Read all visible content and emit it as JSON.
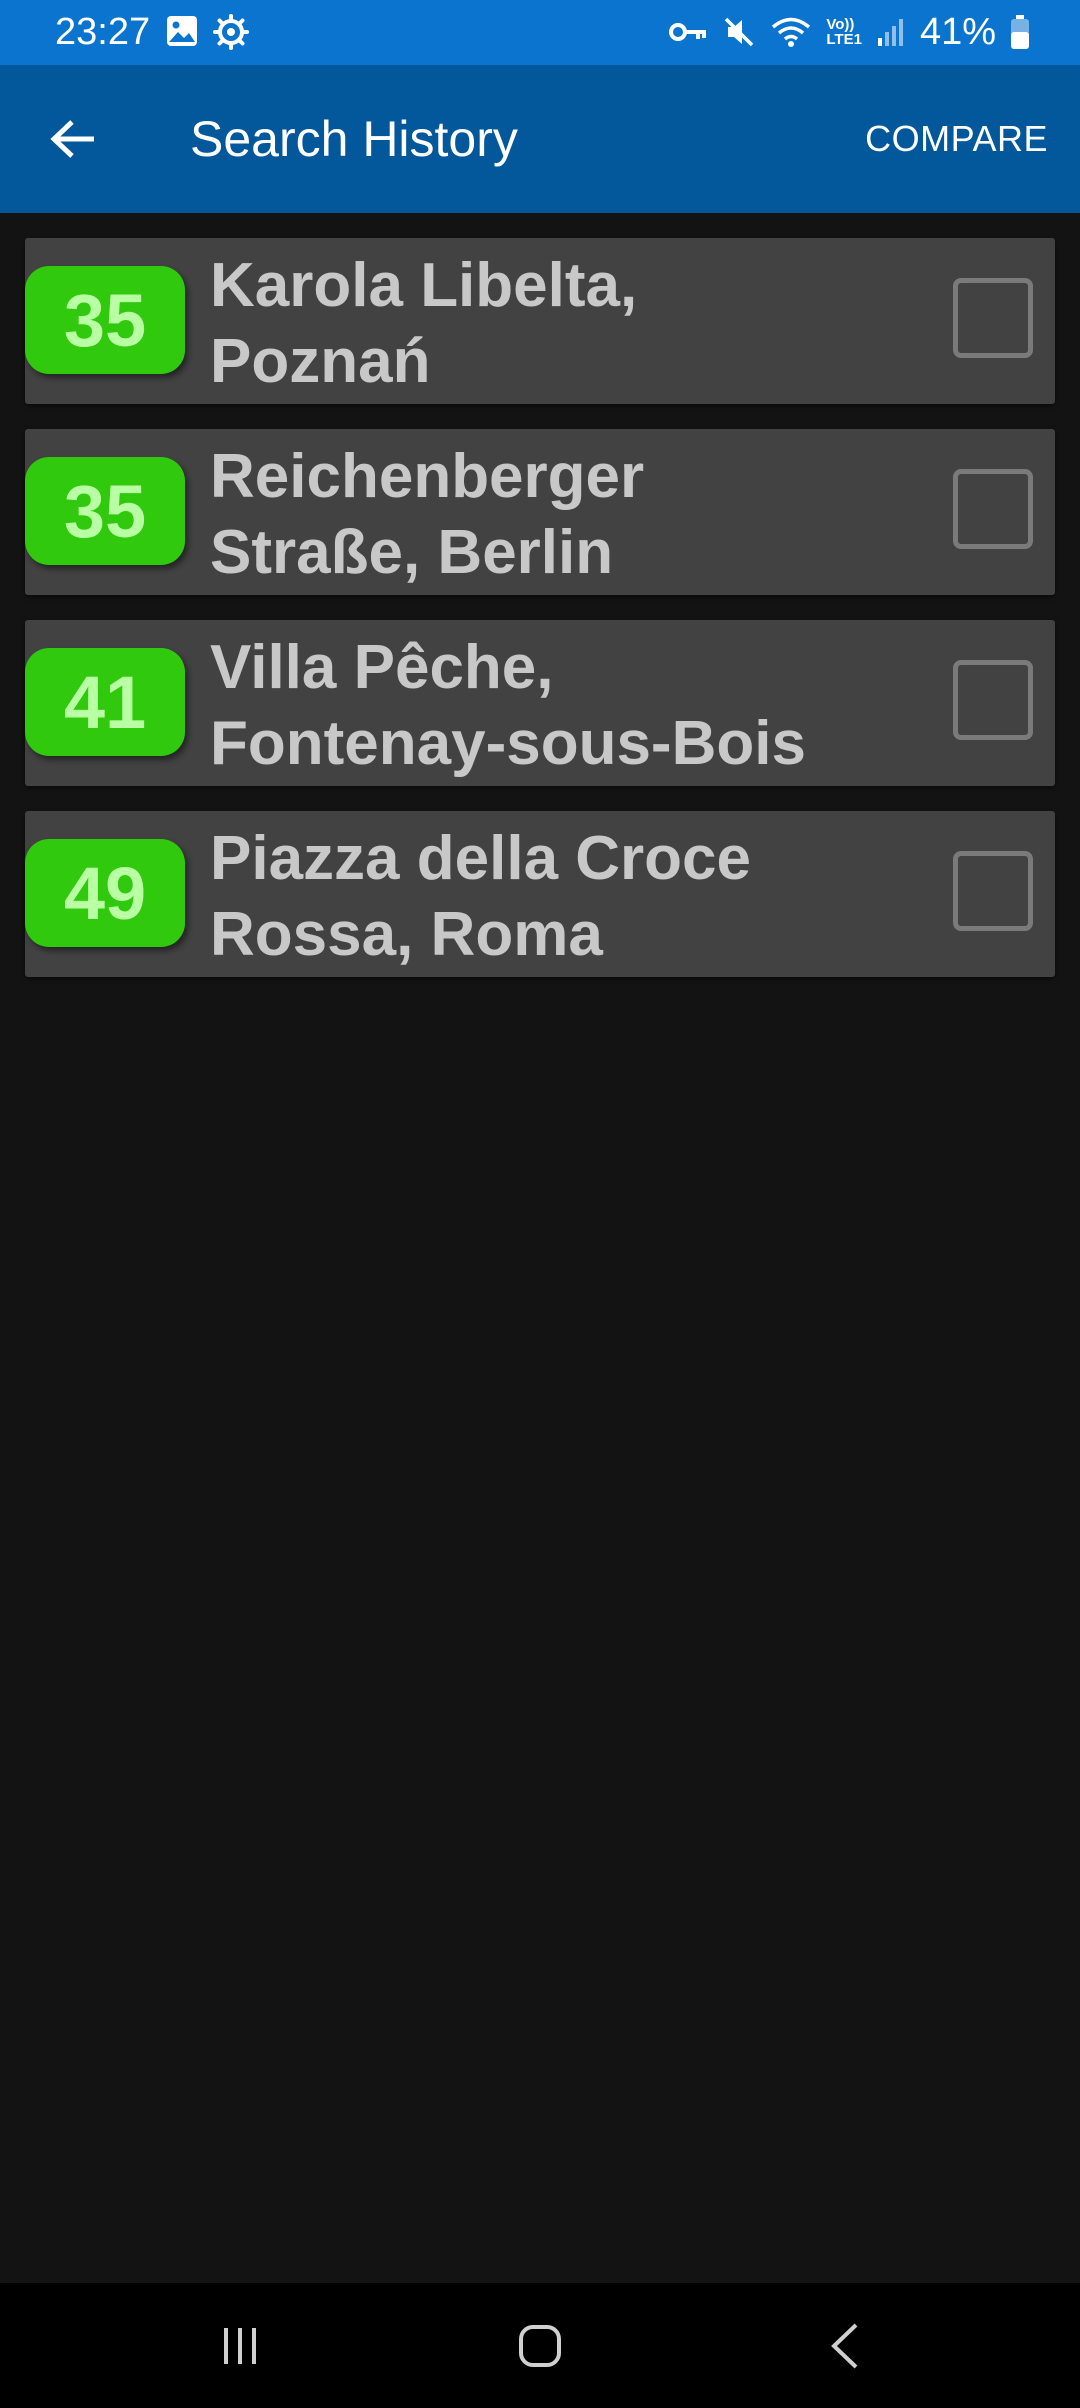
{
  "status_bar": {
    "time": "23:27",
    "left_icons": [
      "image-icon",
      "gear-icon"
    ],
    "right_icons": [
      "vpn-key-icon",
      "mute-icon",
      "wifi-icon",
      "volte-lte-icon",
      "signal-icon",
      "battery-icon"
    ],
    "volte_text": "Vo))",
    "lte_text": "LTE1",
    "battery_percent": "41%"
  },
  "app_bar": {
    "title": "Search History",
    "compare_label": "COMPARE",
    "background": "#03579b"
  },
  "history": [
    {
      "score": "35",
      "line1": "Karola Libelta,",
      "line2": "Poznań",
      "checked": false
    },
    {
      "score": "35",
      "line1": "Reichenberger",
      "line2": "Straße, Berlin",
      "checked": false
    },
    {
      "score": "41",
      "line1": "Villa Pêche,",
      "line2": "Fontenay-sous-Bois",
      "checked": false
    },
    {
      "score": "49",
      "line1": "Piazza della Croce",
      "line2": "Rossa, Roma",
      "checked": false
    }
  ],
  "colors": {
    "badge": "#31c90d",
    "badge_text": "#b9ffa3",
    "card": "#424242",
    "background": "#131313"
  },
  "nav_bar": {
    "buttons": [
      "recent-apps-icon",
      "home-icon",
      "back-icon"
    ]
  }
}
